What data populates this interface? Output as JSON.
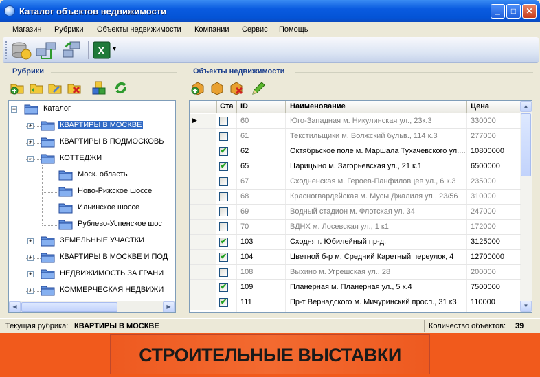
{
  "window": {
    "title": "Каталог объектов недвижимости",
    "min": "_",
    "max": "□",
    "close": "✕"
  },
  "menu": [
    "Магазин",
    "Рубрики",
    "Объекты недвижимости",
    "Компании",
    "Сервис",
    "Помощь"
  ],
  "toolbar": {
    "icons": [
      "database-connect-icon",
      "network-computers-icon",
      "network-sync-icon",
      "excel-export-icon"
    ],
    "dropdown": "▾"
  },
  "left_panel": {
    "title": "Рубрики",
    "toolbar_icons": [
      "add-folder-icon",
      "add-subfolder-icon",
      "edit-folder-icon",
      "delete-folder-icon",
      "cubes-icon",
      "refresh-icon"
    ],
    "tree": [
      {
        "label": "Каталог",
        "level": 0,
        "expanded": true
      },
      {
        "label": "КВАРТИРЫ В МОСКВЕ",
        "level": 1,
        "selected": true,
        "toggle": "+"
      },
      {
        "label": "КВАРТИРЫ В ПОДМОСКОВЬ",
        "level": 1,
        "toggle": "+"
      },
      {
        "label": "КОТТЕДЖИ",
        "level": 1,
        "toggle": "−"
      },
      {
        "label": "Моск. область",
        "level": 2
      },
      {
        "label": "Ново-Рижское шоссе",
        "level": 2
      },
      {
        "label": "Ильинское шоссе",
        "level": 2
      },
      {
        "label": "Рублево-Успенское шос",
        "level": 2
      },
      {
        "label": "ЗЕМЕЛЬНЫЕ УЧАСТКИ",
        "level": 1,
        "toggle": "+"
      },
      {
        "label": "КВАРТИРЫ В МОСКВЕ И ПОД",
        "level": 1,
        "toggle": "+"
      },
      {
        "label": "НЕДВИЖИМОСТЬ ЗА ГРАНИ",
        "level": 1,
        "toggle": "+"
      },
      {
        "label": "КОММЕРЧЕСКАЯ НЕДВИЖИ",
        "level": 1,
        "toggle": "+"
      }
    ]
  },
  "right_panel": {
    "title": "Объекты недвижимости",
    "toolbar_icons": [
      "add-object-icon",
      "edit-object-icon",
      "delete-object-icon",
      "pencil-icon"
    ],
    "columns": [
      "Ста",
      "ID",
      "Наименование",
      "Цена"
    ],
    "rows": [
      {
        "checked": false,
        "id": "60",
        "name": "Юго-Западная м. Никулинская ул., 23к.3",
        "price": "330000",
        "current": true
      },
      {
        "checked": false,
        "id": "61",
        "name": "Текстильщики м. Волжский бульв., 114 к.3",
        "price": "277000"
      },
      {
        "checked": true,
        "id": "62",
        "name": "Октябрьское поле м. Маршала Тухачевского ул....",
        "price": "10800000"
      },
      {
        "checked": true,
        "id": "65",
        "name": "Царицыно м. Загорьевская ул., 21 к.1",
        "price": "6500000"
      },
      {
        "checked": false,
        "id": "67",
        "name": "Сходненская м. Героев-Панфиловцев ул., 6 к.3",
        "price": "235000"
      },
      {
        "checked": false,
        "id": "68",
        "name": "Красногвардейская м. Мусы Джалиля ул., 23/56",
        "price": "310000"
      },
      {
        "checked": false,
        "id": "69",
        "name": "Водный стадион м. Флотская ул. 34",
        "price": "247000"
      },
      {
        "checked": false,
        "id": "70",
        "name": "ВДНХ м. Лосевская ул., 1 к1",
        "price": "172000"
      },
      {
        "checked": true,
        "id": "103",
        "name": "Сходня г. Юбилейный пр-д,",
        "price": "3125000"
      },
      {
        "checked": true,
        "id": "104",
        "name": "Цветной б-р м. Средний Каретный переулок, 4",
        "price": "12700000"
      },
      {
        "checked": false,
        "id": "108",
        "name": "Выхино м. Угрешская ул., 28",
        "price": "200000"
      },
      {
        "checked": true,
        "id": "109",
        "name": "Планерная м. Планерная ул., 5 к.4",
        "price": "7500000"
      },
      {
        "checked": true,
        "id": "111",
        "name": "Пр-т Вернадского м. Мичуринский просп., 31 к3",
        "price": "110000"
      }
    ]
  },
  "status": {
    "current_label": "Текущая рубрика:",
    "current_value": "КВАРТИРЫ В МОСКВЕ",
    "count_label": "Количество объектов:",
    "count_value": "39"
  },
  "banner": {
    "text": "СТРОИТЕЛЬНЫЕ ВЫСТАВКИ"
  },
  "colors": {
    "selection": "#316ac5",
    "banner": "#f15a1c",
    "title_blue": "#0454d6"
  }
}
